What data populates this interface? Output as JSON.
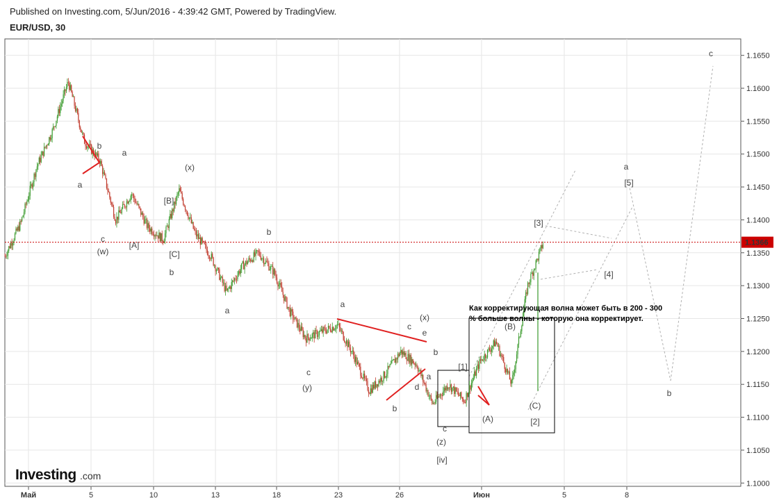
{
  "header": {
    "published": "Published on Investing.com, 5/Jun/2016 - 4:39:42 GMT, Powered by TradingView.",
    "symbol": "EUR/USD, 30"
  },
  "brand": {
    "main": "Investing",
    "sub": ".com"
  },
  "colors": {
    "up": "#3a9a2c",
    "down": "#c0392b",
    "line": "#e02020",
    "price_line": "#cc0000",
    "grid": "#e6e6e6",
    "axis": "#555555",
    "dashed": "#b0b0b0"
  },
  "annotation": {
    "line1": "Как корректирующая волна может быть в 200 - 300",
    "line2": "% больше волны - которую она корректирует."
  },
  "chart_data": {
    "type": "candlestick",
    "title": "EUR/USD, 30",
    "ylim": [
      1.0995,
      1.1675
    ],
    "y_ticks": [
      "1.1650",
      "1.1600",
      "1.1550",
      "1.1500",
      "1.1450",
      "1.1400",
      "1.1350",
      "1.1300",
      "1.1250",
      "1.1200",
      "1.1150",
      "1.1100",
      "1.1050",
      "1.1000"
    ],
    "x_ticks": [
      "Май",
      "5",
      "10",
      "13",
      "18",
      "23",
      "26",
      "Июн",
      "5",
      "8"
    ],
    "last_price": "1.1366",
    "price_path": [
      [
        "Май",
        1.1345
      ],
      [
        "Май",
        1.1395
      ],
      [
        "5",
        1.148
      ],
      [
        "5",
        1.1535
      ],
      [
        "5",
        1.161
      ],
      [
        "5",
        1.152
      ],
      [
        "5",
        1.149
      ],
      [
        "10",
        1.14
      ],
      [
        "10",
        1.144
      ],
      [
        "10",
        1.139
      ],
      [
        "10",
        1.137
      ],
      [
        "10",
        1.1445
      ],
      [
        "13",
        1.138
      ],
      [
        "13",
        1.1345
      ],
      [
        "13",
        1.129
      ],
      [
        "13",
        1.133
      ],
      [
        "18",
        1.135
      ],
      [
        "18",
        1.132
      ],
      [
        "18",
        1.126
      ],
      [
        "18",
        1.122
      ],
      [
        "23",
        1.123
      ],
      [
        "23",
        1.124
      ],
      [
        "23",
        1.1195
      ],
      [
        "26",
        1.114
      ],
      [
        "26",
        1.1165
      ],
      [
        "26",
        1.12
      ],
      [
        "26",
        1.118
      ],
      [
        "26",
        1.112
      ],
      [
        "Июн",
        1.115
      ],
      [
        "Июн",
        1.1125
      ],
      [
        "Июн",
        1.1185
      ],
      [
        "Июн",
        1.1215
      ],
      [
        "Июн",
        1.115
      ],
      [
        "Июн",
        1.13
      ],
      [
        "Июн",
        1.1366
      ]
    ],
    "wave_labels": [
      "b",
      "a",
      "a",
      "c",
      "(x)",
      "(w)",
      "[B]",
      "[A]",
      "[C]",
      "b",
      "b",
      "a",
      "a",
      "c",
      "(y)",
      "c",
      "(x)",
      "e",
      "b",
      "a",
      "d",
      "b",
      "c",
      "(z)",
      "[iv]",
      "[1]",
      "(B)",
      "(A)",
      "(C)",
      "[2]",
      "[3]",
      "[4]",
      "[5]",
      "a",
      "b",
      "c"
    ]
  }
}
